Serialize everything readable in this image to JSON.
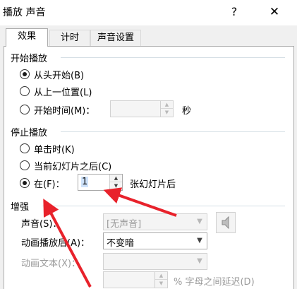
{
  "window": {
    "title": "播放 声音",
    "help_label": "?",
    "close_label": "✕"
  },
  "tabs": [
    {
      "label": "效果",
      "active": true
    },
    {
      "label": "计时",
      "active": false
    },
    {
      "label": "声音设置",
      "active": false
    }
  ],
  "start_group": {
    "title": "开始播放",
    "options": [
      {
        "label": "从头开始(B)",
        "checked": true
      },
      {
        "label": "从上一位置(L)",
        "checked": false
      },
      {
        "label": "开始时间(M)：",
        "checked": false
      }
    ],
    "time_value": "",
    "time_unit": "秒"
  },
  "stop_group": {
    "title": "停止播放",
    "options": [
      {
        "label": "单击时(K)",
        "checked": false
      },
      {
        "label": "当前幻灯片之后(C)",
        "checked": false
      },
      {
        "label": "在(F)：",
        "checked": true
      }
    ],
    "slides_value": "1",
    "slides_suffix": "张幻灯片后"
  },
  "enhance_group": {
    "title": "增强",
    "sound_label": "声音(S)：",
    "sound_value": "[无声音]",
    "after_anim_label": "动画播放后(A)：",
    "after_anim_value": "不变暗",
    "anim_text_label": "动画文本(X)：",
    "anim_text_value": "",
    "delay_value": "",
    "delay_label": "% 字母之间延迟(D)"
  },
  "annotations": {
    "arrow_color": "#e8222b"
  },
  "icons": {
    "sound": "speaker-icon",
    "spin_up": "spin-up-icon",
    "spin_down": "spin-down-icon",
    "dropdown": "chevron-down-icon"
  }
}
